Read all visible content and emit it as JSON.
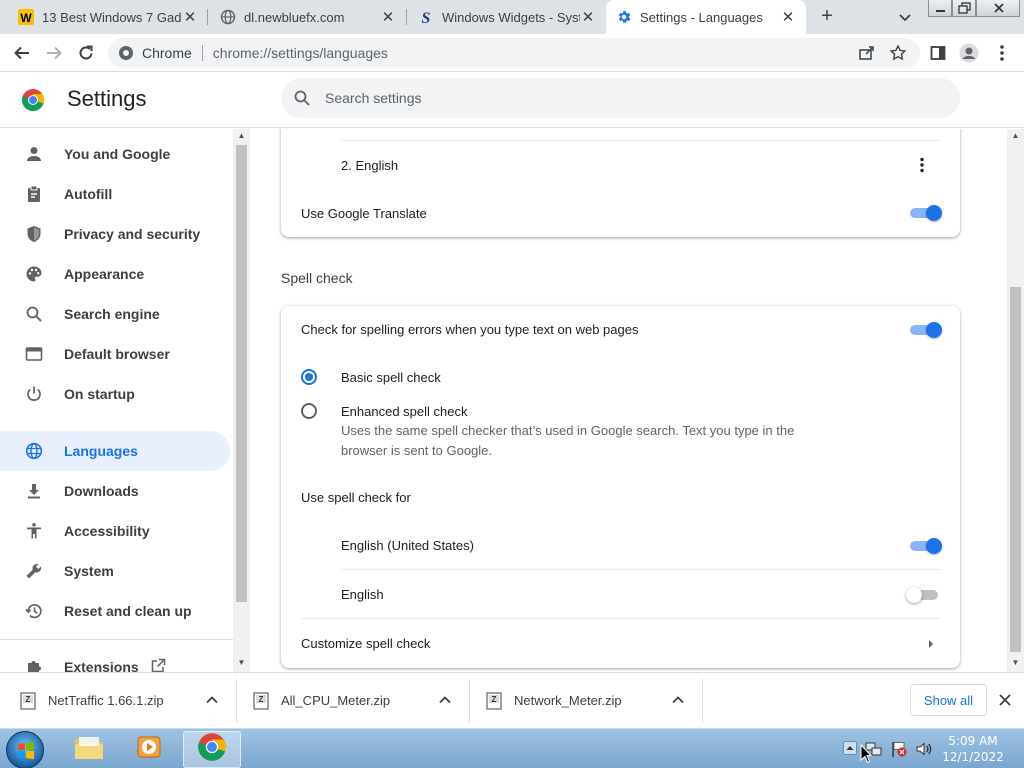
{
  "browser": {
    "tabs": [
      {
        "title": "13 Best Windows 7 Gadg",
        "favicon": "w-letter-icon",
        "active": false
      },
      {
        "title": "dl.newbluefx.com",
        "favicon": "globe-icon",
        "active": false
      },
      {
        "title": "Windows Widgets - Syste",
        "favicon": "s-letter-icon",
        "active": false
      },
      {
        "title": "Settings - Languages",
        "favicon": "gear-icon",
        "active": true
      }
    ],
    "new_tab_label": "+",
    "omnibox": {
      "scheme_label": "Chrome",
      "url": "chrome://settings/languages"
    }
  },
  "settings": {
    "title": "Settings",
    "search_placeholder": "Search settings"
  },
  "sidebar": {
    "items": [
      {
        "label": "You and Google",
        "icon": "person-icon"
      },
      {
        "label": "Autofill",
        "icon": "clipboard-icon"
      },
      {
        "label": "Privacy and security",
        "icon": "shield-icon"
      },
      {
        "label": "Appearance",
        "icon": "palette-icon"
      },
      {
        "label": "Search engine",
        "icon": "search-icon"
      },
      {
        "label": "Default browser",
        "icon": "browser-window-icon"
      },
      {
        "label": "On startup",
        "icon": "power-icon"
      },
      {
        "label": "Languages",
        "icon": "globe-icon",
        "active": true
      },
      {
        "label": "Downloads",
        "icon": "download-icon"
      },
      {
        "label": "Accessibility",
        "icon": "accessibility-icon"
      },
      {
        "label": "System",
        "icon": "wrench-icon"
      },
      {
        "label": "Reset and clean up",
        "icon": "history-icon"
      },
      {
        "label": "Extensions",
        "icon": "puzzle-icon"
      }
    ]
  },
  "languages_card": {
    "language_item": "2. English",
    "translate_label": "Use Google Translate",
    "translate_enabled": true
  },
  "spell_check": {
    "section_title": "Spell check",
    "check_spelling_label": "Check for spelling errors when you type text on web pages",
    "check_spelling_enabled": true,
    "basic_label": "Basic spell check",
    "basic_selected": true,
    "enhanced_label": "Enhanced spell check",
    "enhanced_desc_line1": "Uses the same spell checker that’s used in Google search. Text you type in the",
    "enhanced_desc_line2": "browser is sent to Google.",
    "use_for_label": "Use spell check for",
    "languages": [
      {
        "name": "English (United States)",
        "enabled": true
      },
      {
        "name": "English",
        "enabled": false
      }
    ],
    "customize_label": "Customize spell check"
  },
  "downloads": {
    "items": [
      {
        "name": "NetTraffic 1.66.1.zip"
      },
      {
        "name": "All_CPU_Meter.zip"
      },
      {
        "name": "Network_Meter.zip"
      }
    ],
    "show_all_label": "Show all"
  },
  "taskbar": {
    "time": "5:09 AM",
    "date": "12/1/2022"
  },
  "colors": {
    "accent": "#1a73e8",
    "active_nav_bg": "#e8f0fe",
    "tabstrip_bg": "#dee1e6"
  }
}
